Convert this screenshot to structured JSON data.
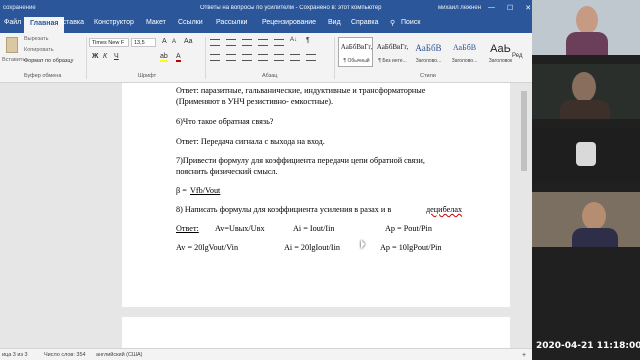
{
  "titlebar": {
    "left": "сохранение",
    "title": "Ответы на вопросы по усилителм  -  Сохранено в: этот компьютер",
    "user": "михаил лежнен",
    "min_icon": "—",
    "max_icon": "☐",
    "close_icon": "✕"
  },
  "tabs": [
    "Файл",
    "Главная",
    "Вставка",
    "Конструктор",
    "Макет",
    "Ссылки",
    "Рассылки",
    "Рецензирование",
    "Вид",
    "Справка",
    "Поиск"
  ],
  "search_icon": "⚲",
  "clipboard": {
    "paste": "Вставить",
    "cut": "Вырезать",
    "copy": "Копировать",
    "format": "Формат по образцу",
    "label": "Буфер обмена"
  },
  "font": {
    "name": "Times New F",
    "size": "13,5",
    "label": "Шрифт",
    "bold": "Ж",
    "italic": "К",
    "underline": "Ч",
    "grow": "A",
    "shrink": "A",
    "case": "Aa",
    "color": "A",
    "highlight": "ab"
  },
  "paragraph": {
    "label": "Абзац",
    "sort": "A↓",
    "marks": "¶"
  },
  "styles": {
    "label": "Стили",
    "items": [
      {
        "sample": "АаБбВвГг,",
        "name": "¶ Обычный"
      },
      {
        "sample": "АаБбВвГг,",
        "name": "¶ Без инте..."
      },
      {
        "sample": "АаБбВ",
        "name": "Заголово..."
      },
      {
        "sample": "АаБбВ",
        "name": "Заголово..."
      },
      {
        "sample": "АаЬ",
        "name": "Заголовок"
      }
    ],
    "editing": "Ред"
  },
  "document": {
    "lines": [
      "Ответ: паразитные, гальванические, индуктивные и трансформаторные",
      "(Применяют в УНЧ резистивно- емкостные).",
      "6)Что такое обратная связь?",
      "Ответ: Передача сигнала с выхода на вход.",
      "7)Привести формулу для коэффициента передачи цепи обратной связи,",
      "пояснить физический смысл.",
      "β =",
      "Vfb/Vout",
      "8) Написать формулы для коэффициента усиления в разах и в ",
      "децибелах",
      "Ответ:",
      "Av=Uвых/Uвх",
      "Ai = Iout/Iin",
      "Ap = Pout/Pin",
      "Av = 20lgVout/Vin",
      "Ai = 20lgIout/Iin",
      "Ap = 10lgPout/Pin"
    ]
  },
  "status": {
    "page": "ица 3 из 3",
    "words": "Число слов: 354",
    "lang": "английский (США)",
    "zoom": "+"
  },
  "video": {
    "timestamp": "2020-04-21 11:18:00"
  }
}
